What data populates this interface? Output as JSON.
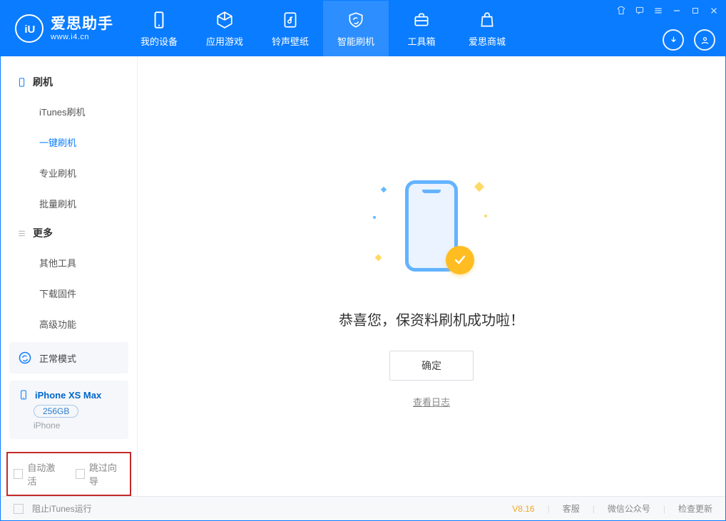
{
  "app": {
    "name": "爱思助手",
    "url": "www.i4.cn"
  },
  "nav": [
    {
      "id": "device",
      "label": "我的设备"
    },
    {
      "id": "apps",
      "label": "应用游戏"
    },
    {
      "id": "ring",
      "label": "铃声壁纸"
    },
    {
      "id": "flash",
      "label": "智能刷机",
      "active": true
    },
    {
      "id": "toolbox",
      "label": "工具箱"
    },
    {
      "id": "store",
      "label": "爱思商城"
    }
  ],
  "sidebar": {
    "section1": {
      "title": "刷机"
    },
    "items1": [
      {
        "label": "iTunes刷机"
      },
      {
        "label": "一键刷机",
        "active": true
      },
      {
        "label": "专业刷机"
      },
      {
        "label": "批量刷机"
      }
    ],
    "section2": {
      "title": "更多"
    },
    "items2": [
      {
        "label": "其他工具"
      },
      {
        "label": "下载固件"
      },
      {
        "label": "高级功能"
      }
    ]
  },
  "mode": {
    "label": "正常模式"
  },
  "device": {
    "name": "iPhone XS Max",
    "capacity": "256GB",
    "type": "iPhone"
  },
  "options": {
    "auto_activate": "自动激活",
    "skip_guide": "跳过向导"
  },
  "main": {
    "success_message": "恭喜您，保资料刷机成功啦！",
    "ok_label": "确定",
    "view_log": "查看日志"
  },
  "footer": {
    "block_itunes": "阻止iTunes运行",
    "version": "V8.16",
    "support": "客服",
    "wechat": "微信公众号",
    "check_update": "检查更新"
  }
}
